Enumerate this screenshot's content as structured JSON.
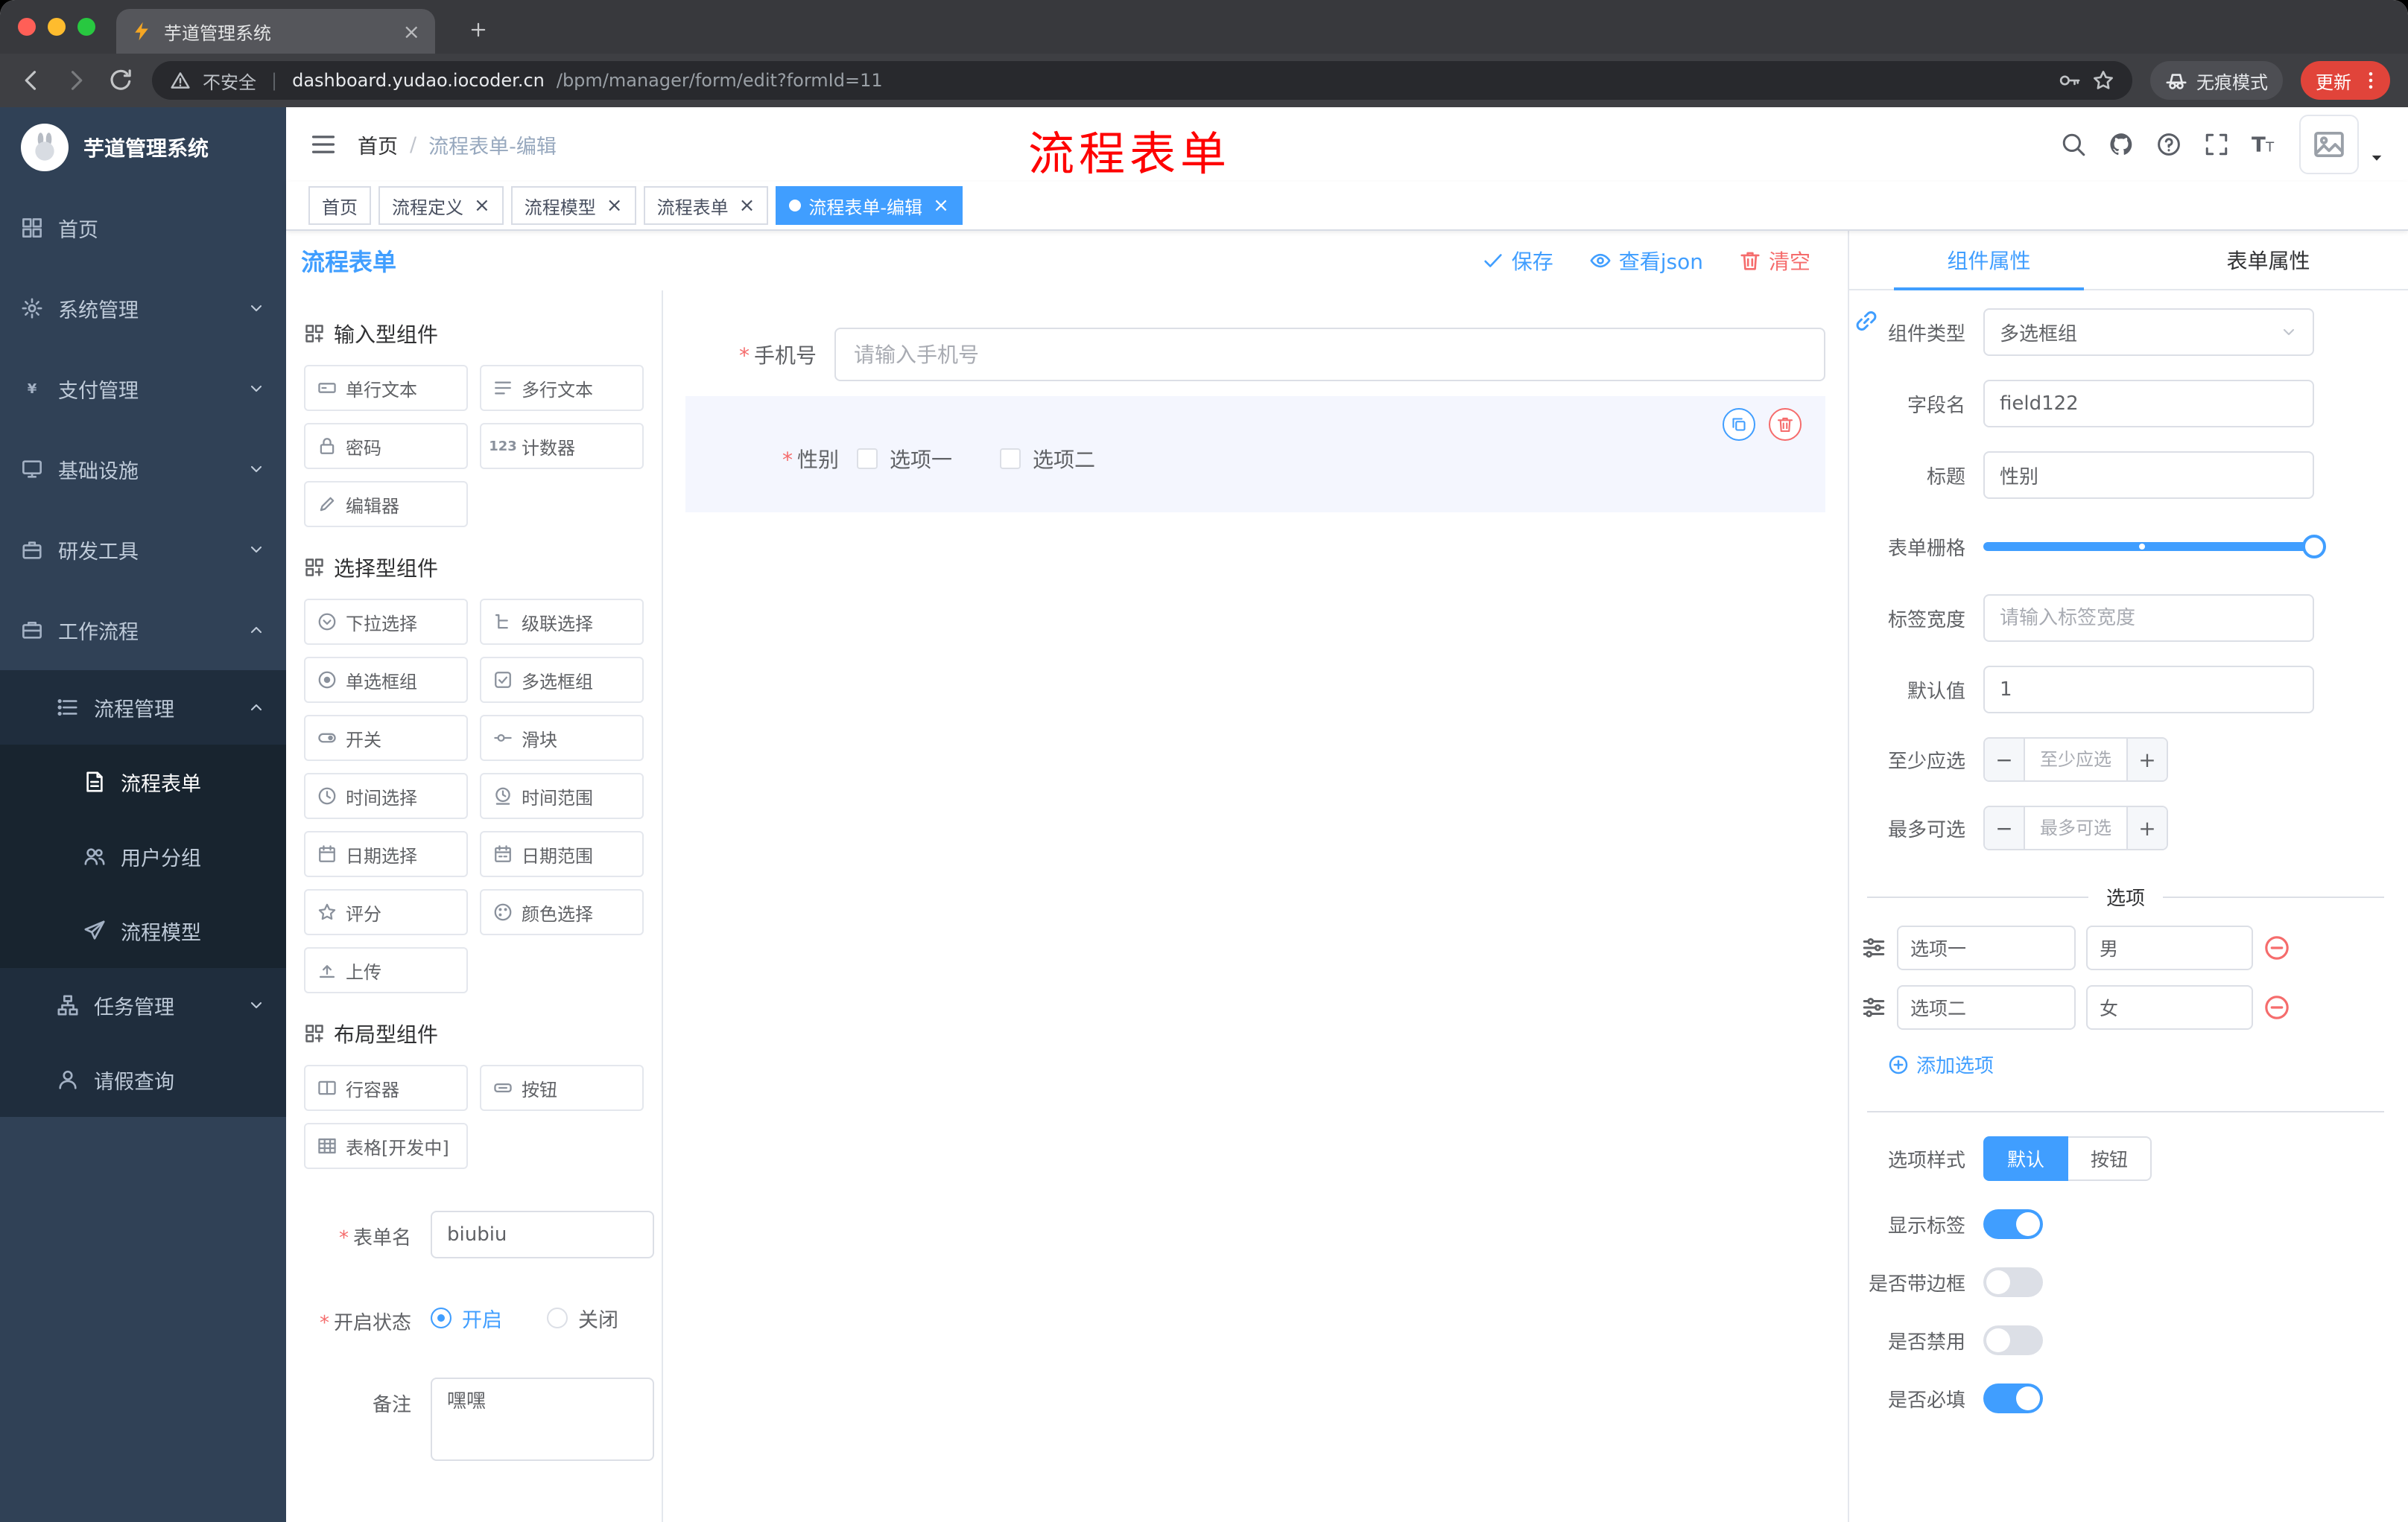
{
  "colors": {
    "primary": "#409eff",
    "danger": "#f56c6c",
    "overlay_red": "#fe0000",
    "sidebar_bg": "#304156",
    "submenu_bg": "#1f2d3d"
  },
  "browser": {
    "tab_title": "芋道管理系统",
    "security_text": "不安全",
    "url_domain": "dashboard.yudao.iocoder.cn",
    "url_path": "/bpm/manager/form/edit?formId=11",
    "incognito_label": "无痕模式",
    "update_label": "更新"
  },
  "sidebar": {
    "logo_title": "芋道管理系统",
    "items": [
      {
        "id": "home",
        "icon": "dashboard-icon",
        "label": "首页",
        "level": 1
      },
      {
        "id": "system-management",
        "icon": "gear-icon",
        "label": "系统管理",
        "level": 1,
        "chevron": "down"
      },
      {
        "id": "payment-management",
        "icon": "yen-icon",
        "label": "支付管理",
        "level": 1,
        "chevron": "down"
      },
      {
        "id": "infrastructure",
        "icon": "infrastructure-icon",
        "label": "基础设施",
        "level": 1,
        "chevron": "down"
      },
      {
        "id": "dev-tools",
        "icon": "tools-icon",
        "label": "研发工具",
        "level": 1,
        "chevron": "down"
      },
      {
        "id": "workflow",
        "icon": "briefcase-icon",
        "label": "工作流程",
        "level": 1,
        "chevron": "up"
      },
      {
        "id": "process-management",
        "icon": "list-icon",
        "label": "流程管理",
        "level": 2,
        "chevron": "up"
      },
      {
        "id": "process-form",
        "icon": "document-icon",
        "label": "流程表单",
        "level": 3,
        "active": true
      },
      {
        "id": "user-group",
        "icon": "users-icon",
        "label": "用户分组",
        "level": 3
      },
      {
        "id": "process-model",
        "icon": "send-icon",
        "label": "流程模型",
        "level": 3
      },
      {
        "id": "task-management",
        "icon": "tree-icon",
        "label": "任务管理",
        "level": 2,
        "chevron": "down"
      },
      {
        "id": "leave-query",
        "icon": "user-icon",
        "label": "请假查询",
        "level": 2
      }
    ]
  },
  "header": {
    "breadcrumb_home": "首页",
    "breadcrumb_current": "流程表单-编辑",
    "overlay_title": "流程表单"
  },
  "tags_bar": [
    {
      "label": "首页"
    },
    {
      "label": "流程定义",
      "closable": true
    },
    {
      "label": "流程模型",
      "closable": true
    },
    {
      "label": "流程表单",
      "closable": true
    },
    {
      "label": "流程表单-编辑",
      "closable": true,
      "active": true
    }
  ],
  "editor": {
    "title": "流程表单",
    "save": "保存",
    "view_json": "查看json",
    "clear": "清空"
  },
  "palette": {
    "groups": [
      {
        "title": "输入型组件",
        "items": [
          {
            "icon": "single-line-text-icon",
            "label": "单行文本"
          },
          {
            "icon": "multi-line-text-icon",
            "label": "多行文本"
          },
          {
            "icon": "password-icon",
            "label": "密码"
          },
          {
            "icon": "counter-icon",
            "label": "计数器"
          },
          {
            "icon": "editor-icon",
            "label": "编辑器"
          }
        ]
      },
      {
        "title": "选择型组件",
        "items": [
          {
            "icon": "select-icon",
            "label": "下拉选择"
          },
          {
            "icon": "cascader-icon",
            "label": "级联选择"
          },
          {
            "icon": "radio-group-icon",
            "label": "单选框组"
          },
          {
            "icon": "checkbox-group-icon",
            "label": "多选框组"
          },
          {
            "icon": "switch-icon",
            "label": "开关"
          },
          {
            "icon": "slider-icon",
            "label": "滑块"
          },
          {
            "icon": "time-icon",
            "label": "时间选择"
          },
          {
            "icon": "time-range-icon",
            "label": "时间范围"
          },
          {
            "icon": "date-icon",
            "label": "日期选择"
          },
          {
            "icon": "date-range-icon",
            "label": "日期范围"
          },
          {
            "icon": "rate-icon",
            "label": "评分"
          },
          {
            "icon": "color-icon",
            "label": "颜色选择"
          },
          {
            "icon": "upload-icon",
            "label": "上传"
          }
        ]
      },
      {
        "title": "布局型组件",
        "items": [
          {
            "icon": "row-container-icon",
            "label": "行容器"
          },
          {
            "icon": "button-icon",
            "label": "按钮"
          },
          {
            "icon": "table-icon",
            "label": "表格[开发中]"
          }
        ]
      }
    ]
  },
  "form_meta": {
    "name_label": "表单名",
    "name_value": "biubiu",
    "status_label": "开启状态",
    "status_on": "开启",
    "status_off": "关闭",
    "remark_label": "备注",
    "remark_value": "嘿嘿"
  },
  "canvas": {
    "phone": {
      "label": "手机号",
      "required": true,
      "placeholder": "请输入手机号"
    },
    "gender": {
      "label": "性别",
      "required": true,
      "options": [
        "选项一",
        "选项二"
      ],
      "selected": true
    }
  },
  "props": {
    "tabs": [
      "组件属性",
      "表单属性"
    ],
    "active_tab": "组件属性",
    "component_type_label": "组件类型",
    "component_type_value": "多选框组",
    "field_name_label": "字段名",
    "field_name_value": "field122",
    "title_label": "标题",
    "title_value": "性别",
    "grid_label": "表单栅格",
    "label_width_label": "标签宽度",
    "label_width_placeholder": "请输入标签宽度",
    "default_label": "默认值",
    "default_value": "1",
    "min_label": "至少应选",
    "min_placeholder": "至少应选",
    "max_label": "最多可选",
    "max_placeholder": "最多可选",
    "options_title": "选项",
    "options": [
      {
        "label": "选项一",
        "value": "男"
      },
      {
        "label": "选项二",
        "value": "女"
      }
    ],
    "add_option_label": "添加选项",
    "style_label": "选项样式",
    "style_options": [
      "默认",
      "按钮"
    ],
    "style_selected": "默认",
    "switches": [
      {
        "id": "show-label",
        "label": "显示标签",
        "on": true
      },
      {
        "id": "with-border",
        "label": "是否带边框",
        "on": false
      },
      {
        "id": "disabled",
        "label": "是否禁用",
        "on": false
      },
      {
        "id": "required",
        "label": "是否必填",
        "on": true
      }
    ]
  }
}
